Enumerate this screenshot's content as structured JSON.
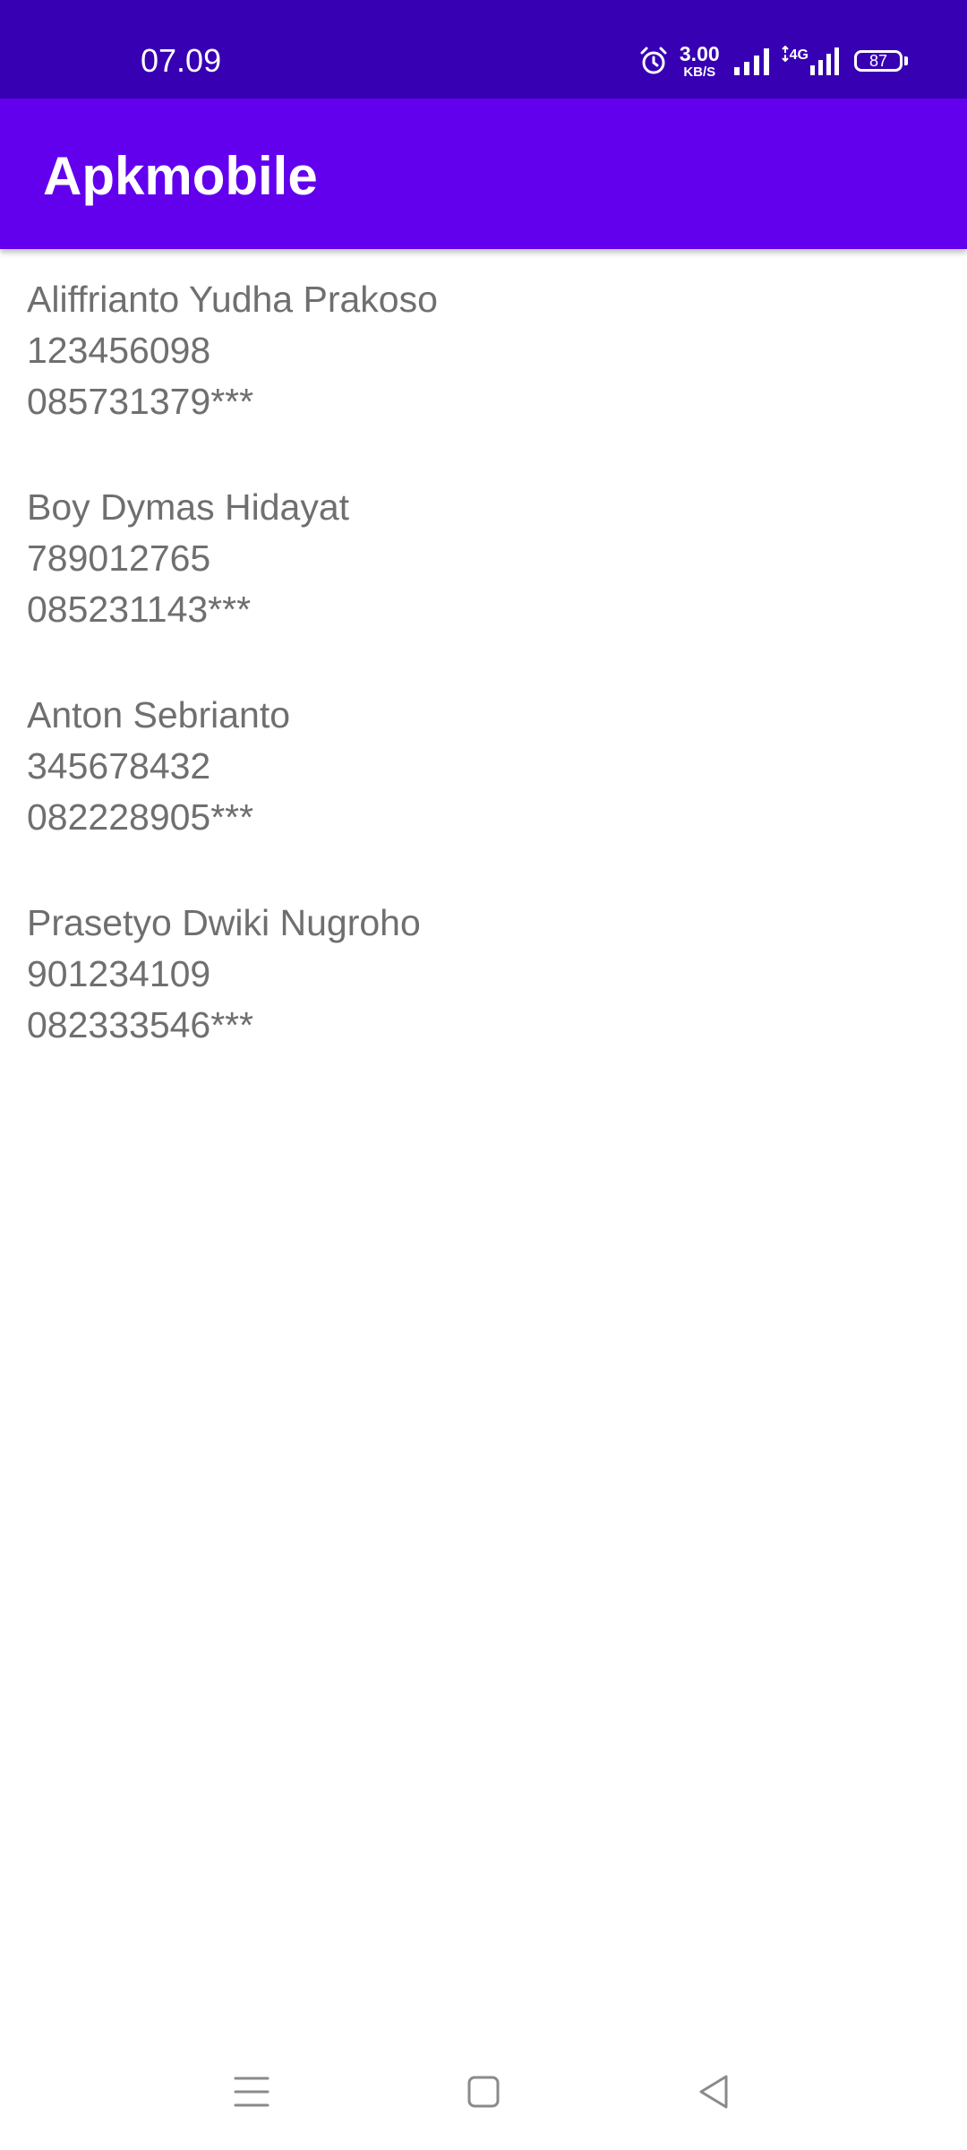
{
  "status_bar": {
    "time": "07.09",
    "net_speed_value": "3.00",
    "net_speed_unit": "KB/S",
    "network_type": "4G",
    "battery_level": "87",
    "icons": [
      "alarm-icon",
      "signal-icon",
      "signal-4g-icon",
      "battery-icon"
    ],
    "background_color": "#3700B3"
  },
  "app_bar": {
    "title": "Apkmobile",
    "background_color": "#6200EE"
  },
  "list": {
    "items": [
      {
        "name": "Aliffrianto Yudha Prakoso",
        "id": "123456098",
        "phone": "085731379***"
      },
      {
        "name": "Boy Dymas Hidayat",
        "id": "789012765",
        "phone": "085231143***"
      },
      {
        "name": "Anton Sebrianto",
        "id": "345678432",
        "phone": "082228905***"
      },
      {
        "name": "Prasetyo Dwiki Nugroho",
        "id": "901234109",
        "phone": "082333546***"
      }
    ],
    "text_color": "#6f6f6f"
  },
  "nav_bar": {
    "buttons": [
      "menu-icon",
      "home-icon",
      "back-icon"
    ]
  }
}
